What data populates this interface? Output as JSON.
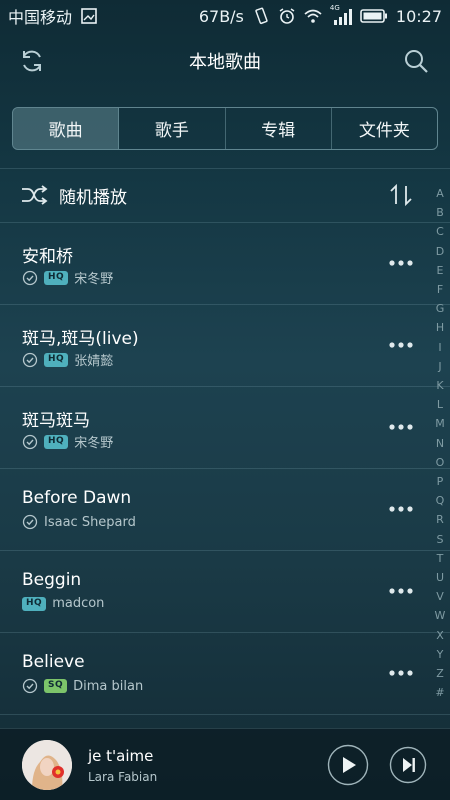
{
  "statusbar": {
    "carrier": "中国移动",
    "speed": "67B/s",
    "network": "4G",
    "time": "10:27"
  },
  "header": {
    "title": "本地歌曲",
    "icons": [
      "refresh-icon",
      "search-icon"
    ]
  },
  "tabs": [
    {
      "label": "歌曲",
      "active": true
    },
    {
      "label": "歌手",
      "active": false
    },
    {
      "label": "专辑",
      "active": false
    },
    {
      "label": "文件夹",
      "active": false
    }
  ],
  "shuffle": {
    "label": "随机播放",
    "icons": [
      "shuffle-icon",
      "sort-icon"
    ]
  },
  "songs": [
    {
      "name": "安和桥",
      "artist": "宋冬野",
      "checked": true,
      "quality": "HQ"
    },
    {
      "name": "斑马,斑马(live)",
      "artist": "张婧懿",
      "checked": true,
      "quality": "HQ"
    },
    {
      "name": "斑马斑马",
      "artist": "宋冬野",
      "checked": true,
      "quality": "HQ"
    },
    {
      "name": "Before Dawn",
      "artist": "Isaac Shepard",
      "checked": true,
      "quality": ""
    },
    {
      "name": "Beggin",
      "artist": "madcon",
      "checked": false,
      "quality": "HQ"
    },
    {
      "name": "Believe",
      "artist": "Dima bilan",
      "checked": true,
      "quality": "SQ"
    }
  ],
  "index_letters": [
    "A",
    "B",
    "C",
    "D",
    "E",
    "F",
    "G",
    "H",
    "I",
    "J",
    "K",
    "L",
    "M",
    "N",
    "O",
    "P",
    "Q",
    "R",
    "S",
    "T",
    "U",
    "V",
    "W",
    "X",
    "Y",
    "Z",
    "#"
  ],
  "now_playing": {
    "track": "je t'aime",
    "artist": "Lara Fabian"
  },
  "colors": {
    "hq_badge": "#4fb0bd",
    "sq_badge": "#7cc46a",
    "background": "#173a47"
  }
}
